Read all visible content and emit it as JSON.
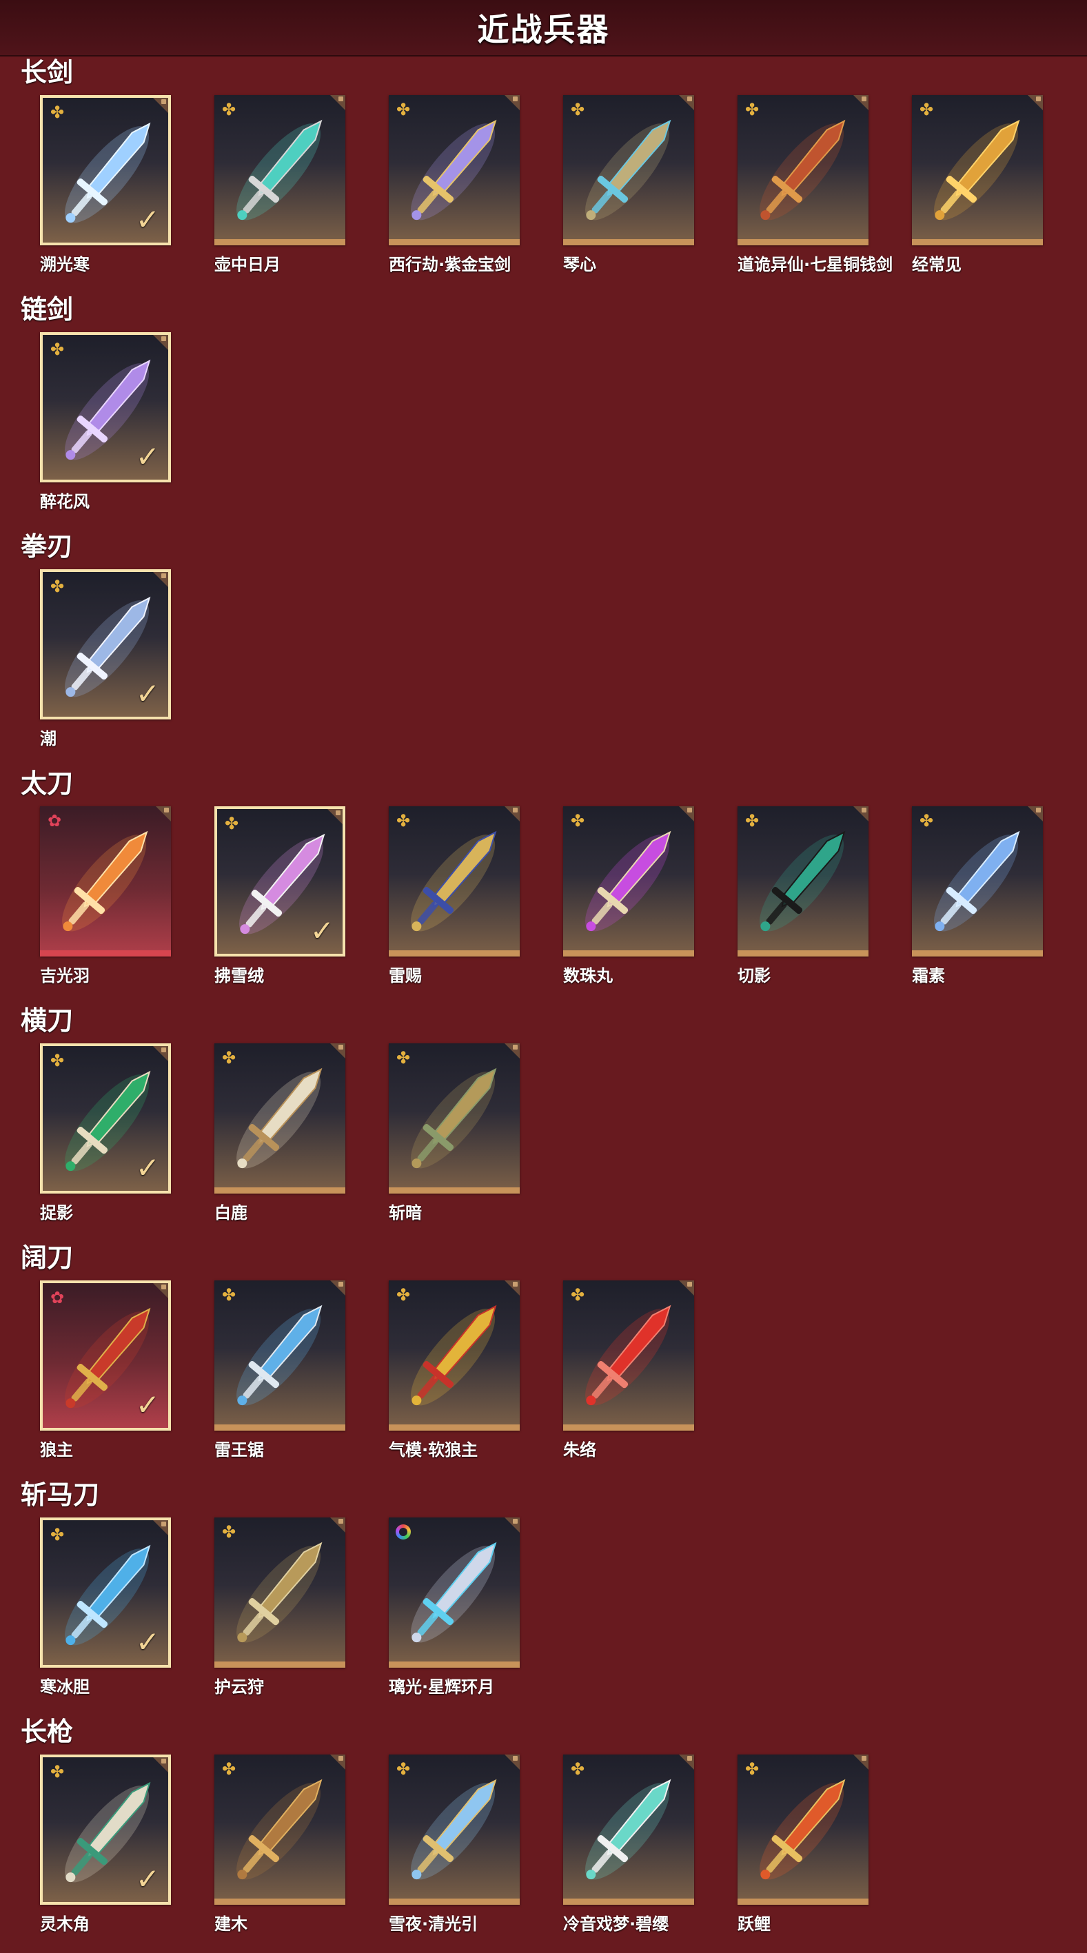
{
  "header": {
    "title": "近战兵器"
  },
  "colors": {
    "background": "#681a1f",
    "header": "#3b0d12",
    "card_bottom_gold": "#c8935a",
    "card_bottom_red": "#d6454f",
    "selected_border": "#f6e2ad",
    "rarity_gold": "#e4b13f",
    "rarity_pink": "#e2435a"
  },
  "icons": {
    "gold": "✤",
    "pink": "✿",
    "check": "✓"
  },
  "sections": [
    {
      "title": "长剑",
      "items": [
        {
          "name": "溯光寒",
          "rarity": "gold",
          "selected": true,
          "color": "#9fd0ff",
          "accent": "#e8f6ff"
        },
        {
          "name": "壶中日月",
          "rarity": "gold",
          "selected": false,
          "color": "#4ecfc0",
          "accent": "#d7d7d7"
        },
        {
          "name": "西行劫·紫金宝剑",
          "rarity": "gold",
          "selected": false,
          "color": "#a493e8",
          "accent": "#e6c36a"
        },
        {
          "name": "琴心",
          "rarity": "gold",
          "selected": false,
          "color": "#bfae7a",
          "accent": "#6ac7e0"
        },
        {
          "name": "道诡异仙·七星铜钱剑",
          "rarity": "gold",
          "selected": false,
          "color": "#c0542f",
          "accent": "#e09a4a"
        },
        {
          "name": "经常见",
          "rarity": "gold",
          "selected": false,
          "color": "#e1a23a",
          "accent": "#ffd36a"
        }
      ]
    },
    {
      "title": "链剑",
      "items": [
        {
          "name": "醉花风",
          "rarity": "gold",
          "selected": true,
          "color": "#b08be8",
          "accent": "#e9d6ff"
        }
      ]
    },
    {
      "title": "拳刃",
      "items": [
        {
          "name": "潮",
          "rarity": "gold",
          "selected": true,
          "color": "#9db8e6",
          "accent": "#f0f4ff"
        }
      ]
    },
    {
      "title": "太刀",
      "items": [
        {
          "name": "吉光羽",
          "rarity": "pink",
          "selected": false,
          "red": true,
          "color": "#f08a3a",
          "accent": "#ffe1a8"
        },
        {
          "name": "拂雪绒",
          "rarity": "gold",
          "selected": true,
          "color": "#d58be0",
          "accent": "#f2f2f2"
        },
        {
          "name": "雷赐",
          "rarity": "gold",
          "selected": false,
          "color": "#d8b45a",
          "accent": "#3c4ea8"
        },
        {
          "name": "数珠丸",
          "rarity": "gold",
          "selected": false,
          "color": "#c74de0",
          "accent": "#e8d8b0"
        },
        {
          "name": "切影",
          "rarity": "gold",
          "selected": false,
          "color": "#2fa58a",
          "accent": "#1a1a1a"
        },
        {
          "name": "霜素",
          "rarity": "gold",
          "selected": false,
          "color": "#7fb0f0",
          "accent": "#d8ecff"
        }
      ]
    },
    {
      "title": "横刀",
      "items": [
        {
          "name": "捉影",
          "rarity": "gold",
          "selected": true,
          "color": "#2fae6a",
          "accent": "#e8dcc0"
        },
        {
          "name": "白鹿",
          "rarity": "gold",
          "selected": false,
          "color": "#e7ddc4",
          "accent": "#b9925a"
        },
        {
          "name": "斩暗",
          "rarity": "gold",
          "selected": false,
          "color": "#b49a5a",
          "accent": "#8a9a6a"
        }
      ]
    },
    {
      "title": "阔刀",
      "items": [
        {
          "name": "狼主",
          "rarity": "pink",
          "selected": true,
          "red": true,
          "color": "#c93a2a",
          "accent": "#e0b04a"
        },
        {
          "name": "雷王锯",
          "rarity": "gold",
          "selected": false,
          "color": "#5fb0e8",
          "accent": "#dfe8f0"
        },
        {
          "name": "气模·软狼主",
          "rarity": "gold",
          "selected": false,
          "color": "#e3b43a",
          "accent": "#c8322a"
        },
        {
          "name": "朱络",
          "rarity": "gold",
          "selected": false,
          "color": "#e0322a",
          "accent": "#f08070"
        }
      ]
    },
    {
      "title": "斩马刀",
      "items": [
        {
          "name": "寒冰胆",
          "rarity": "gold",
          "selected": true,
          "color": "#4fb0e8",
          "accent": "#bfe6ff"
        },
        {
          "name": "护云狩",
          "rarity": "gold",
          "selected": false,
          "color": "#b89a5a",
          "accent": "#e0d0a0"
        },
        {
          "name": "璃光·星辉环月",
          "rarity": "ring",
          "selected": false,
          "color": "#cfd8ea",
          "accent": "#5fd0f0"
        }
      ]
    },
    {
      "title": "长枪",
      "items": [
        {
          "name": "灵木角",
          "rarity": "gold",
          "selected": true,
          "color": "#e2dcc8",
          "accent": "#3a9a7a"
        },
        {
          "name": "建木",
          "rarity": "gold",
          "selected": false,
          "color": "#b07a40",
          "accent": "#e0b060"
        },
        {
          "name": "雪夜·清光引",
          "rarity": "gold",
          "selected": false,
          "color": "#8fc6f0",
          "accent": "#e0c070"
        },
        {
          "name": "冷音戏梦·碧缨",
          "rarity": "gold",
          "selected": false,
          "color": "#6ad8c8",
          "accent": "#f0f0f0"
        },
        {
          "name": "跃鲤",
          "rarity": "gold",
          "selected": false,
          "color": "#e05a2a",
          "accent": "#e8c060"
        }
      ]
    }
  ]
}
